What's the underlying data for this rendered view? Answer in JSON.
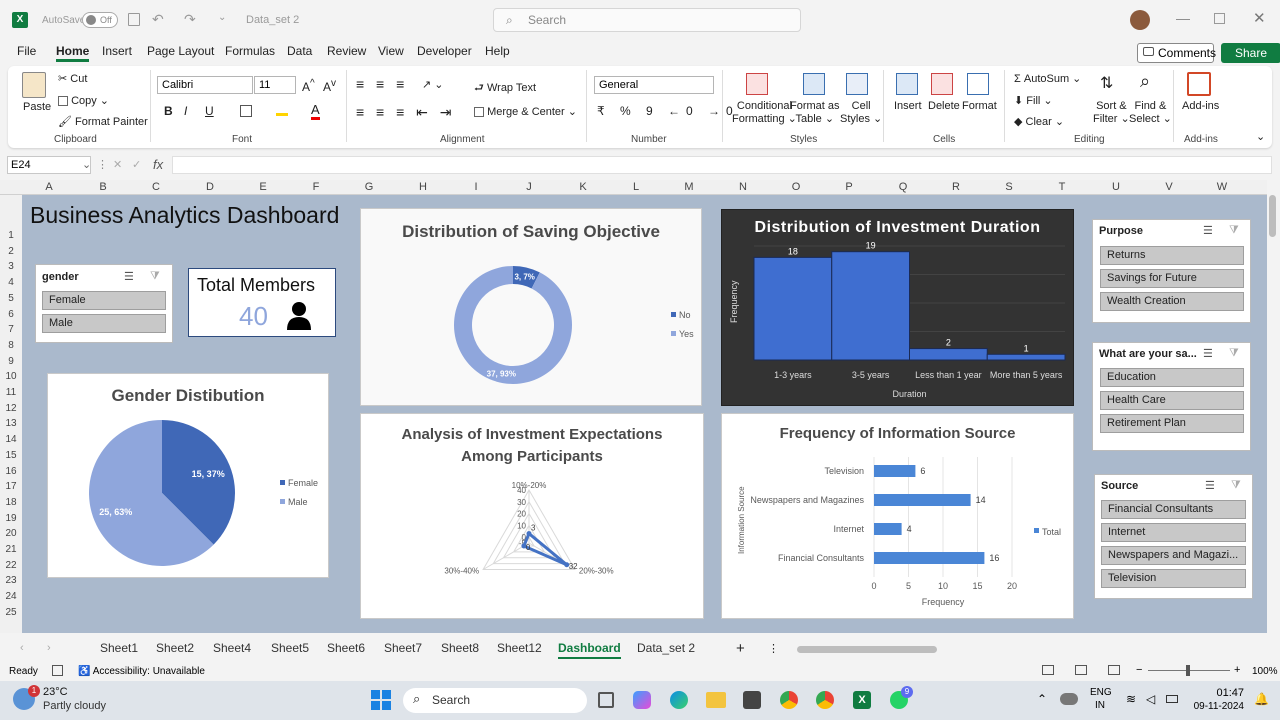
{
  "titlebar": {
    "autosave": "AutoSave",
    "autosave_state": "Off",
    "filename": "Data_set 2",
    "search_placeholder": "Search"
  },
  "menu": [
    "File",
    "Home",
    "Insert",
    "Page Layout",
    "Formulas",
    "Data",
    "Review",
    "View",
    "Developer",
    "Help"
  ],
  "comments": "Comments",
  "share": "Share",
  "ribbon": {
    "paste": "Paste",
    "cut": "Cut",
    "copy": "Copy",
    "format_painter": "Format Painter",
    "clipboard": "Clipboard",
    "font_name": "Calibri",
    "font_size": "11",
    "font": "Font",
    "wrap_text": "Wrap Text",
    "merge_center": "Merge & Center",
    "alignment": "Alignment",
    "number_format": "General",
    "number": "Number",
    "conditional": "Conditional",
    "formatting": "Formatting",
    "format_as": "Format as",
    "table": "Table",
    "cell": "Cell",
    "styles_l": "Styles",
    "styles": "Styles",
    "insert": "Insert",
    "delete": "Delete",
    "format": "Format",
    "cells": "Cells",
    "autosum": "AutoSum",
    "fill": "Fill",
    "clear": "Clear",
    "sort": "Sort &",
    "filter": "Filter",
    "find": "Find &",
    "select": "Select",
    "editing": "Editing",
    "addins": "Add-ins",
    "addins_grp": "Add-ins"
  },
  "formula_bar": {
    "name_box": "E24",
    "fx": "fx"
  },
  "columns": [
    "A",
    "B",
    "C",
    "D",
    "E",
    "F",
    "G",
    "H",
    "I",
    "J",
    "K",
    "L",
    "M",
    "N",
    "O",
    "P",
    "Q",
    "R",
    "S",
    "T",
    "U",
    "V",
    "W"
  ],
  "rows": [
    "1",
    "2",
    "3",
    "4",
    "5",
    "6",
    "7",
    "8",
    "9",
    "10",
    "11",
    "12",
    "13",
    "14",
    "15",
    "16",
    "17",
    "18",
    "19",
    "20",
    "21",
    "22",
    "23",
    "24",
    "25"
  ],
  "dashboard": {
    "title": "Business Analytics Dashboard",
    "gender_slicer": {
      "title": "gender",
      "items": [
        "Female",
        "Male"
      ]
    },
    "total_members": {
      "label": "Total Members",
      "value": "40"
    },
    "purpose_slicer": {
      "title": "Purpose",
      "items": [
        "Returns",
        "Savings for Future",
        "Wealth Creation"
      ]
    },
    "savings_slicer": {
      "title": "What are your sa...",
      "items": [
        "Education",
        "Health Care",
        "Retirement Plan"
      ]
    },
    "source_slicer": {
      "title": "Source",
      "items": [
        "Financial Consultants",
        "Internet",
        "Newspapers and Magazi...",
        "Television"
      ]
    }
  },
  "chart_data": [
    {
      "type": "pie",
      "title": "Gender Distibution",
      "categories": [
        "Female",
        "Male"
      ],
      "values": [
        15,
        25
      ],
      "labels": [
        "15, 37%",
        "25, 63%"
      ],
      "legend": "right",
      "colors": [
        "#4068b7",
        "#8fa6dc"
      ]
    },
    {
      "type": "pie",
      "title": "Distribution of Saving Objective",
      "categories": [
        "No",
        "Yes"
      ],
      "values": [
        3,
        37
      ],
      "labels": [
        "3, 7%",
        "37, 93%"
      ],
      "legend": "right",
      "colors": [
        "#4068b7",
        "#8fa6dc"
      ]
    },
    {
      "type": "bar",
      "title": "Distribution of Investment Duration",
      "categories": [
        "1-3 years",
        "3-5 years",
        "Less than 1 year",
        "More than 5 years"
      ],
      "values": [
        18,
        19,
        2,
        1
      ],
      "xlabel": "Duration",
      "ylabel": "Frequency",
      "ylim": [
        0,
        20
      ]
    },
    {
      "type": "radar",
      "title": "Analysis of Investment Expectations Among Participants",
      "categories": [
        "10%-20%",
        "20%-30%",
        "30%-40%"
      ],
      "values": [
        3,
        32,
        0
      ],
      "labels": [
        "3",
        "32",
        "0"
      ],
      "scale_ticks": [
        "40",
        "30",
        "20",
        "10",
        "0",
        "-5"
      ],
      "ylim": [
        -5,
        40
      ]
    },
    {
      "type": "bar",
      "title": "Frequency of Information Source",
      "categories": [
        "Television",
        "Newspapers and Magazines",
        "Internet",
        "Financial Consultants"
      ],
      "values": [
        6,
        14,
        4,
        16
      ],
      "xlabel": "Frequency",
      "ylabel": "Information Source",
      "xlim": [
        0,
        20
      ],
      "x_ticks": [
        "0",
        "5",
        "10",
        "15",
        "20"
      ],
      "legend": "right",
      "series_name": "Total"
    }
  ],
  "sheet_tabs": [
    "Sheet1",
    "Sheet2",
    "Sheet4",
    "Sheet5",
    "Sheet6",
    "Sheet7",
    "Sheet8",
    "Sheet12",
    "Dashboard",
    "Data_set 2"
  ],
  "status": {
    "ready": "Ready",
    "accessibility": "Accessibility: Unavailable",
    "zoom": "100%"
  },
  "taskbar": {
    "temp": "23°C",
    "weather": "Partly cloudy",
    "search": "Search",
    "lang1": "ENG",
    "lang2": "IN",
    "time": "01:47",
    "date": "09-11-2024",
    "weather_badge": "1",
    "whatsapp_badge": "9"
  },
  "colors": {
    "accent": "#107c41",
    "series_dark": "#4068b7",
    "series_light": "#8fa6dc",
    "sheet_bg": "#aab9cc"
  }
}
